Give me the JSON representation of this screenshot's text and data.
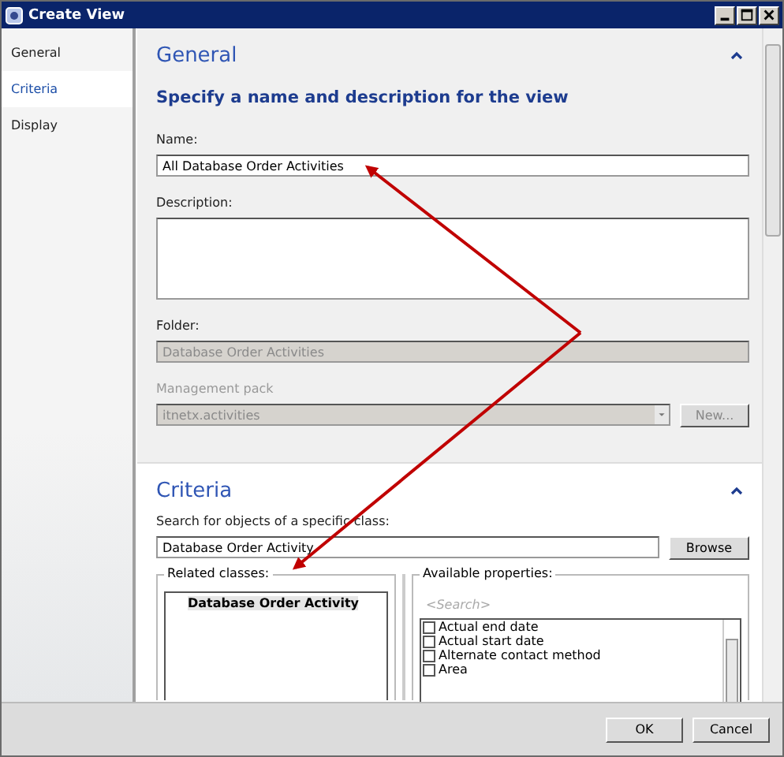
{
  "window": {
    "title": "Create View"
  },
  "sidebar": {
    "items": [
      {
        "label": "General",
        "selected": false
      },
      {
        "label": "Criteria",
        "selected": true
      },
      {
        "label": "Display",
        "selected": false
      }
    ]
  },
  "general": {
    "heading": "General",
    "subheading": "Specify a name and description for the view",
    "name_label": "Name:",
    "name_value": "All Database Order Activities",
    "description_label": "Description:",
    "folder_label": "Folder:",
    "folder_value": "Database Order Activities",
    "folder_disabled": true,
    "management_pack_label": "Management pack",
    "management_pack_value": "itnetx.activities",
    "management_pack_disabled": true,
    "new_button": "New...",
    "new_disabled": true
  },
  "criteria": {
    "heading": "Criteria",
    "search_label": "Search for objects of a specific class:",
    "search_value": "Database Order Activity",
    "browse_button": "Browse",
    "related_classes_label": "Related classes:",
    "related_classes": [
      "Database Order Activity"
    ],
    "available_properties_label": "Available properties:",
    "property_search_placeholder": "<Search>",
    "properties": [
      {
        "label": "Actual end date",
        "checked": false
      },
      {
        "label": "Actual start date",
        "checked": false
      },
      {
        "label": "Alternate contact method",
        "checked": false
      },
      {
        "label": "Area",
        "checked": false
      }
    ]
  },
  "buttons": [
    "OK",
    "Cancel"
  ]
}
